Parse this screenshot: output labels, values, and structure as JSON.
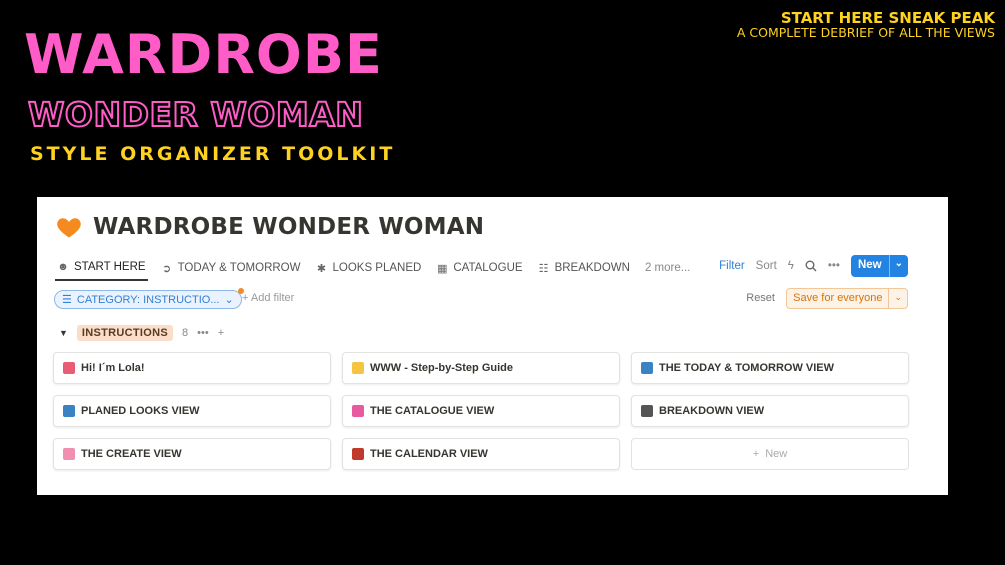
{
  "banner": {
    "title": "WARDROBE",
    "subtitle": "WONDER WOMAN",
    "tagline": "STYLE ORGANIZER TOOLKIT",
    "corner_title": "START HERE SNEAK PEAK",
    "corner_sub": "A COMPLETE DEBRIEF OF ALL THE VIEWS"
  },
  "page": {
    "icon": "orange-heart-icon",
    "title": "WARDROBE WONDER WOMAN"
  },
  "tabs": [
    {
      "label": "START HERE",
      "icon": "smiley-icon",
      "active": true
    },
    {
      "label": "TODAY & TOMORROW",
      "icon": "arrow-circle-icon"
    },
    {
      "label": "LOOKS PLANED",
      "icon": "asterisk-icon"
    },
    {
      "label": "CATALOGUE",
      "icon": "gallery-grid-icon"
    },
    {
      "label": "BREAKDOWN",
      "icon": "table-icon"
    },
    {
      "label": "2 more..."
    }
  ],
  "toolbar": {
    "filter_label": "Filter",
    "sort_label": "Sort",
    "new_label": "New",
    "lightning_icon": "lightning-icon",
    "search_icon": "search-icon",
    "more_icon": "more-horizontal-icon"
  },
  "filters": {
    "chip_label": "CATEGORY: INSTRUCTIO...",
    "add_filter_label": "Add filter",
    "reset_label": "Reset",
    "save_label": "Save for everyone"
  },
  "group": {
    "label": "INSTRUCTIONS",
    "count": "8"
  },
  "cards": [
    {
      "label": "Hi! I´m Lola!",
      "icon": "love-letter-icon",
      "color": "#e85d75"
    },
    {
      "label": "WWW - Step-by-Step Guide",
      "icon": "dizzy-star-icon",
      "color": "#f5c542"
    },
    {
      "label": "THE TODAY & TOMORROW VIEW",
      "icon": "right-arrow-icon",
      "color": "#3b82c4"
    },
    {
      "label": "PLANED LOOKS VIEW",
      "icon": "sparkle-box-icon",
      "color": "#3b82c4"
    },
    {
      "label": "THE CATALOGUE VIEW",
      "icon": "shopping-bags-icon",
      "color": "#e75aa0"
    },
    {
      "label": "BREAKDOWN VIEW",
      "icon": "notebook-icon",
      "color": "#555555"
    },
    {
      "label": "THE CREATE VIEW",
      "icon": "brain-icon",
      "color": "#f08fb0"
    },
    {
      "label": "THE CALENDAR VIEW",
      "icon": "calendar-icon",
      "color": "#c0392b"
    }
  ],
  "new_card_label": "New",
  "colors": {
    "pink": "#ff5cc8",
    "yellow": "#ffd21f",
    "accent_blue": "#2383e2",
    "save_orange": "#d9730d"
  }
}
